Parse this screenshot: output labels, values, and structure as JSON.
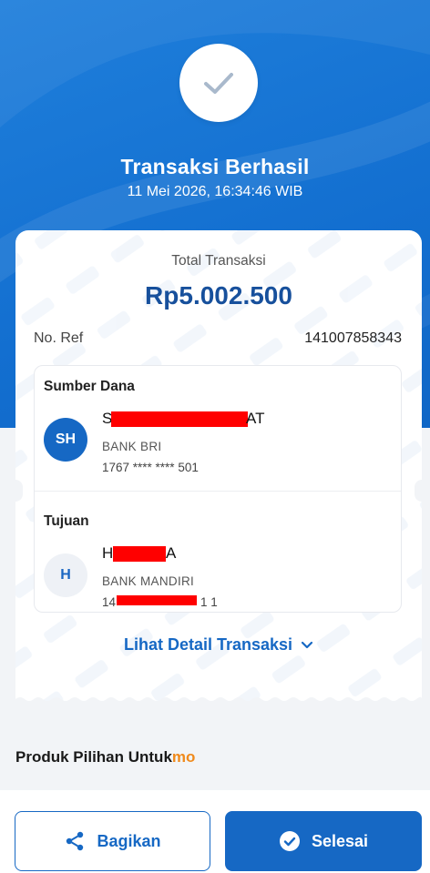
{
  "header": {
    "title": "Transaksi Berhasil",
    "datetime": "11 Mei 2026, 16:34:46 WIB"
  },
  "receipt": {
    "total_label": "Total Transaksi",
    "total_amount": "Rp5.002.500",
    "ref_label": "No. Ref",
    "ref_value": "141007858343",
    "source": {
      "label": "Sumber Dana",
      "initials": "SH",
      "name_start": "S",
      "name_end": "AT",
      "bank": "BANK BRI",
      "account": "1767 **** **** 501"
    },
    "destination": {
      "label": "Tujuan",
      "initials": "H",
      "name_start": "H",
      "name_end": "A",
      "bank": "BANK MANDIRI",
      "account_start": "14",
      "account_end": "1 1"
    },
    "detail_link": "Lihat Detail Transaksi"
  },
  "promo": {
    "label": "Produk Pilihan Untuk",
    "brand_suffix": "mo"
  },
  "actions": {
    "share_label": "Bagikan",
    "done_label": "Selesai"
  },
  "colors": {
    "primary": "#1668c4",
    "amount": "#17509c",
    "accent": "#f08a1c",
    "redaction": "#ff0000"
  },
  "icons": {
    "success": "check-icon",
    "share": "share-icon",
    "done": "check-circle-icon",
    "expand": "chevron-down-icon"
  }
}
